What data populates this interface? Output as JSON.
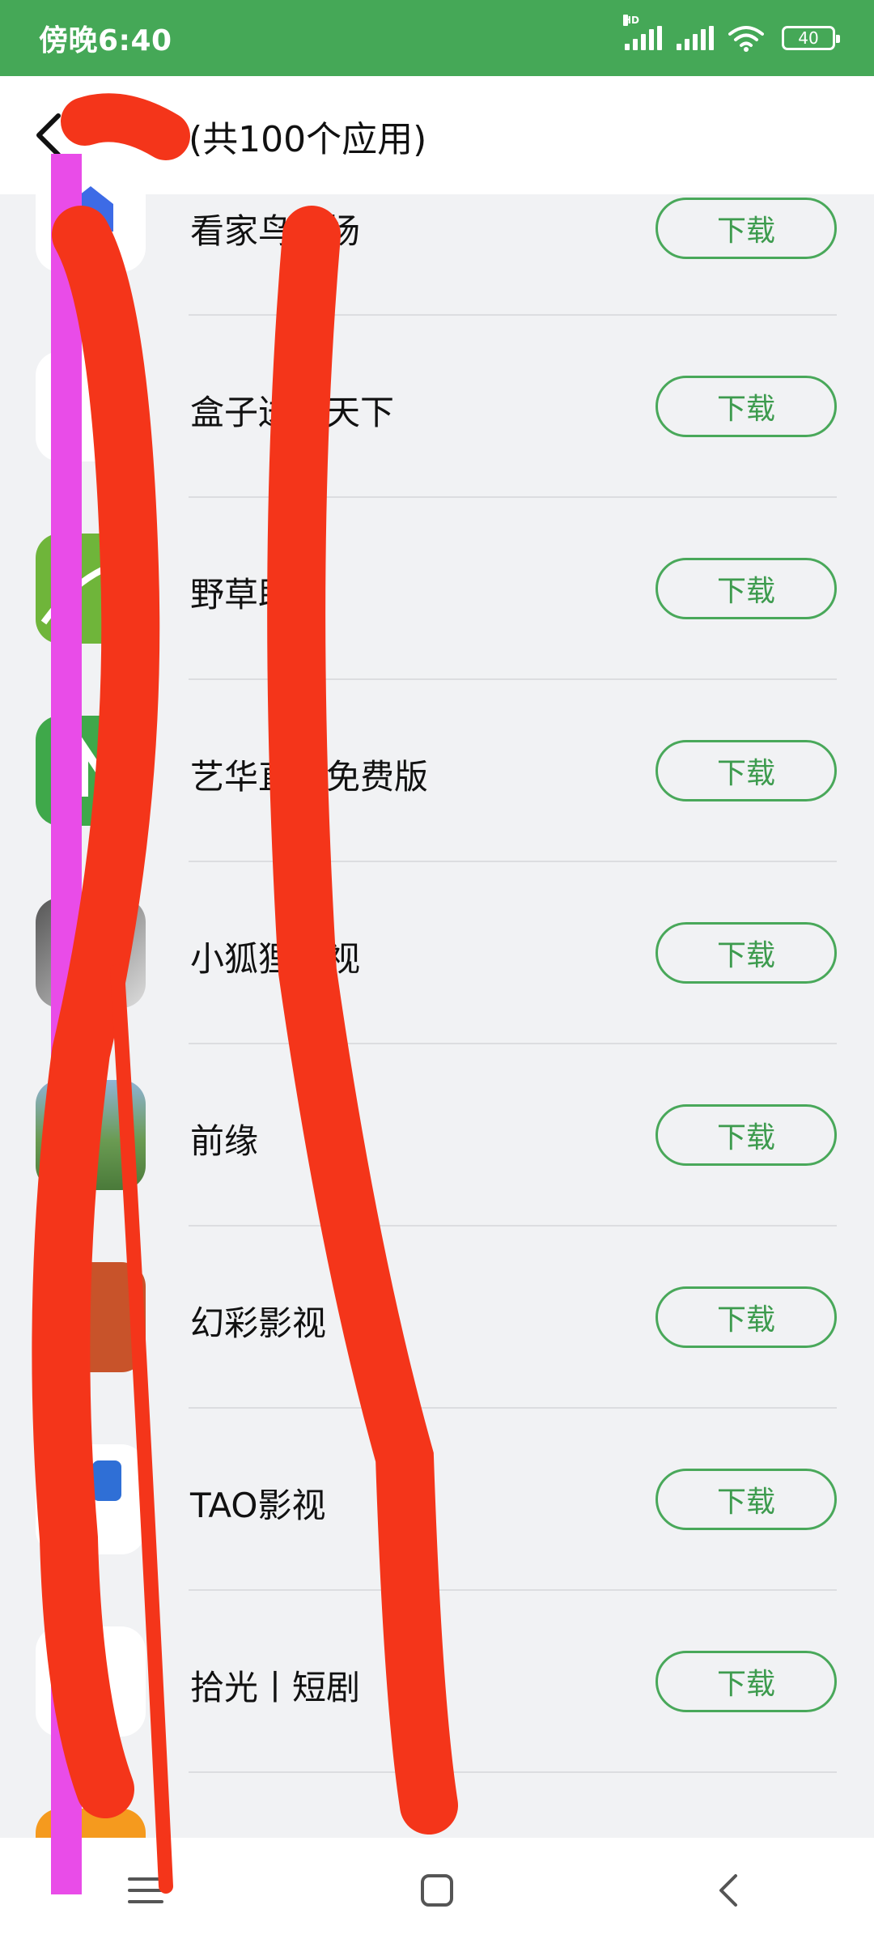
{
  "status_bar": {
    "time": "傍晚6:40",
    "network_badge": "HD",
    "battery": "40"
  },
  "header": {
    "title": "7(共100个应用)",
    "back_icon": "chevron-left-icon"
  },
  "colors": {
    "status_green": "#45a857",
    "button_green": "#49a85a",
    "list_background": "#f1f2f4",
    "scribble_red": "#f4351a",
    "scribble_magenta": "#e94ce8"
  },
  "apps": [
    {
      "name": "看家鸟市场",
      "button": "下载",
      "icon_color": "#ffffff"
    },
    {
      "name": "盒子送盈天下",
      "button": "下载",
      "icon_color": "#ffffff"
    },
    {
      "name": "野草助",
      "button": "下载",
      "icon_color": "#6fb53a"
    },
    {
      "name": "艺华直播免费版",
      "button": "下载",
      "icon_color": "#3fa84a"
    },
    {
      "name": "小狐狸影视",
      "button": "下载",
      "icon_color": "#7a7a7a"
    },
    {
      "name": "前缘",
      "button": "下载",
      "icon_color": "#6a9b52"
    },
    {
      "name": "幻彩影视",
      "button": "下载",
      "icon_color": "#c8532a"
    },
    {
      "name": "TAO影视",
      "button": "下载",
      "icon_color": "#ffffff"
    },
    {
      "name": "拾光丨短剧",
      "button": "下载",
      "icon_color": "#ffffff"
    }
  ],
  "nav_bar": {
    "menu_icon": "menu-icon",
    "home_icon": "home-square-icon",
    "back_icon": "back-triangle-icon"
  }
}
